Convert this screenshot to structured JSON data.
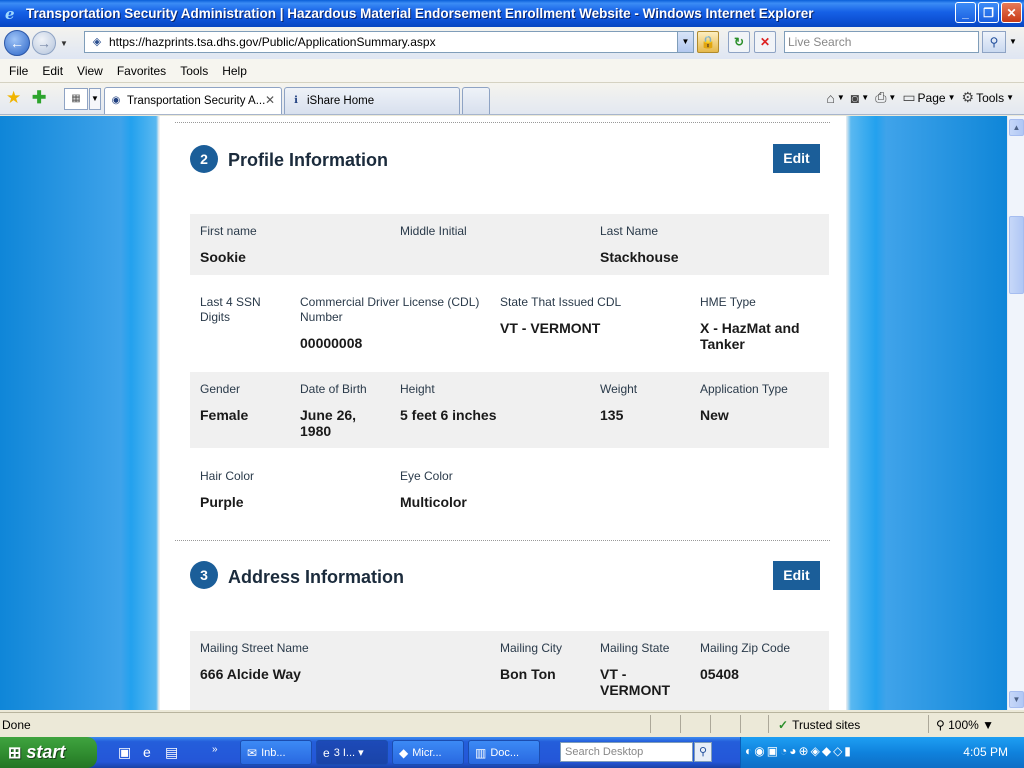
{
  "window": {
    "title": "Transportation Security Administration | Hazardous Material Endorsement Enrollment Website - Windows Internet Explorer",
    "min_glyph": "_",
    "max_glyph": "❐",
    "close_glyph": "✕"
  },
  "address_bar": {
    "url": "https://hazprints.tsa.dhs.gov/Public/ApplicationSummary.aspx",
    "search_placeholder": "Live Search"
  },
  "menu": [
    "File",
    "Edit",
    "View",
    "Favorites",
    "Tools",
    "Help"
  ],
  "tabs": [
    {
      "label": "Transportation Security A...",
      "active": true
    },
    {
      "label": "iShare Home",
      "active": false
    }
  ],
  "command_bar": {
    "page_label": "Page",
    "tools_label": "Tools"
  },
  "sections": [
    {
      "number": "2",
      "title": "Profile Information",
      "edit_label": "Edit",
      "rows": [
        {
          "fields": [
            {
              "label": "First name",
              "value": "Sookie"
            },
            {
              "label": "Middle Initial",
              "value": ""
            },
            {
              "label": "Last Name",
              "value": "Stackhouse"
            }
          ]
        },
        {
          "fields": [
            {
              "label": "Last 4 SSN Digits",
              "value": ""
            },
            {
              "label": "Commercial Driver License (CDL) Number",
              "value": "00000008"
            },
            {
              "label": "State That Issued CDL",
              "value": "VT - VERMONT"
            },
            {
              "label": "HME Type",
              "value": "X - HazMat and Tanker"
            }
          ]
        },
        {
          "fields": [
            {
              "label": "Gender",
              "value": "Female"
            },
            {
              "label": "Date of Birth",
              "value": "June 26, 1980"
            },
            {
              "label": "Height",
              "value": "5 feet 6 inches"
            },
            {
              "label": "Weight",
              "value": "135"
            },
            {
              "label": "Application Type",
              "value": "New"
            }
          ]
        },
        {
          "fields": [
            {
              "label": "Hair Color",
              "value": "Purple"
            },
            {
              "label": "Eye Color",
              "value": "Multicolor"
            }
          ]
        }
      ]
    },
    {
      "number": "3",
      "title": "Address Information",
      "edit_label": "Edit",
      "rows": [
        {
          "fields": [
            {
              "label": "Mailing Street Name",
              "value": "666 Alcide Way"
            },
            {
              "label": "Mailing City",
              "value": "Bon Ton"
            },
            {
              "label": "Mailing State",
              "value": "VT - VERMONT"
            },
            {
              "label": "Mailing Zip Code",
              "value": "05408"
            }
          ]
        }
      ]
    }
  ],
  "status_bar": {
    "status": "Done",
    "zone": "Trusted sites",
    "zoom": "100%"
  },
  "taskbar": {
    "start_label": "start",
    "tasks": [
      "Inb...",
      "3 I...",
      "Micr...",
      "Doc..."
    ],
    "search_placeholder": "Search Desktop",
    "clock": "4:05 PM"
  },
  "colors": {
    "section_blue": "#1b5e99",
    "row_shade": "#f0f0f0",
    "page_bg": "#ffffff"
  }
}
